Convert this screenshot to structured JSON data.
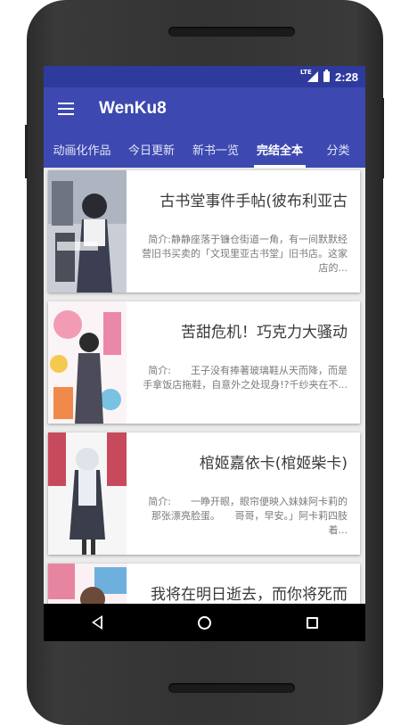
{
  "status_bar": {
    "network": "LTE",
    "time": "2:28"
  },
  "app_bar": {
    "title": "WenKu8"
  },
  "tabs": [
    {
      "label": "动画化作品",
      "active": false
    },
    {
      "label": "今日更新",
      "active": false
    },
    {
      "label": "新书一览",
      "active": false
    },
    {
      "label": "完结全本",
      "active": true
    },
    {
      "label": "分类",
      "active": false
    }
  ],
  "books": [
    {
      "title": "古书堂事件手帖(彼布利亚古",
      "description": "简介:静静座落于镰仓街道一角，有一间默默经营旧书买卖的「文现里亚古书堂」旧书店。这家店的..."
    },
    {
      "title": "苦甜危机！巧克力大骚动",
      "description": "简介:　　王子没有捧著玻璃鞋从天而降，而是手拿饭店拖鞋，自意外之处现身!?千纱夹在不..."
    },
    {
      "title": "棺姬嘉依卡(棺姬柴卡)",
      "description": "简介:　　一睁开眼，眼帘便映入妹妹阿卡莉的那张漂亮脸蛋。　　哥哥，早安。」阿卡莉四肢着..."
    },
    {
      "title": "我将在明日逝去，而你将死而",
      "description": ""
    }
  ],
  "colors": {
    "primary": "#3d49b0",
    "status_bar": "#2f3a9e",
    "indicator": "#ffffff"
  },
  "icons": [
    "menu-icon",
    "lte-signal-icon",
    "battery-icon",
    "back-icon",
    "home-icon",
    "recent-apps-icon"
  ]
}
